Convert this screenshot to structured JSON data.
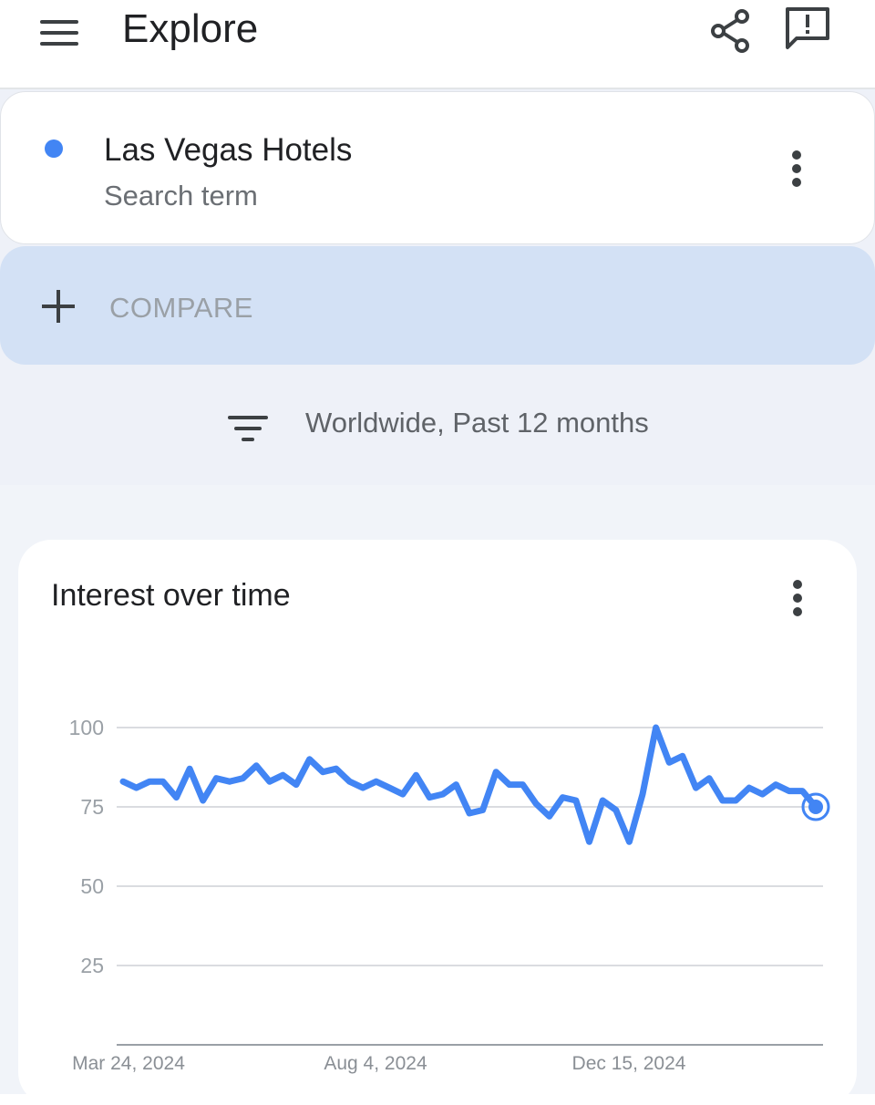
{
  "header": {
    "title": "Explore",
    "icons": [
      "menu-icon",
      "share-icon",
      "feedback-icon"
    ]
  },
  "search_term": {
    "name": "Las Vegas Hotels",
    "type": "Search term",
    "color": "#4285f4"
  },
  "compare": {
    "label": "COMPARE"
  },
  "filters": {
    "summary": "Worldwide, Past 12 months"
  },
  "chart_card": {
    "title": "Interest over time"
  },
  "chart_data": {
    "type": "line",
    "title": "Interest over time",
    "xlabel": "",
    "ylabel": "",
    "ylim": [
      0,
      100
    ],
    "yticks": [
      25,
      50,
      75,
      100
    ],
    "x_tick_labels": [
      "Mar 24, 2024",
      "Aug 4, 2024",
      "Dec 15, 2024"
    ],
    "grid": true,
    "series": [
      {
        "color": "#4285f4",
        "values": [
          83,
          81,
          83,
          83,
          78,
          87,
          77,
          84,
          83,
          84,
          88,
          83,
          85,
          82,
          90,
          86,
          87,
          83,
          81,
          83,
          81,
          79,
          85,
          78,
          79,
          82,
          73,
          74,
          86,
          82,
          82,
          76,
          72,
          78,
          77,
          64,
          77,
          74,
          64,
          79,
          100,
          89,
          91,
          81,
          84,
          77,
          77,
          81,
          79,
          82,
          80,
          80,
          75
        ]
      }
    ]
  }
}
